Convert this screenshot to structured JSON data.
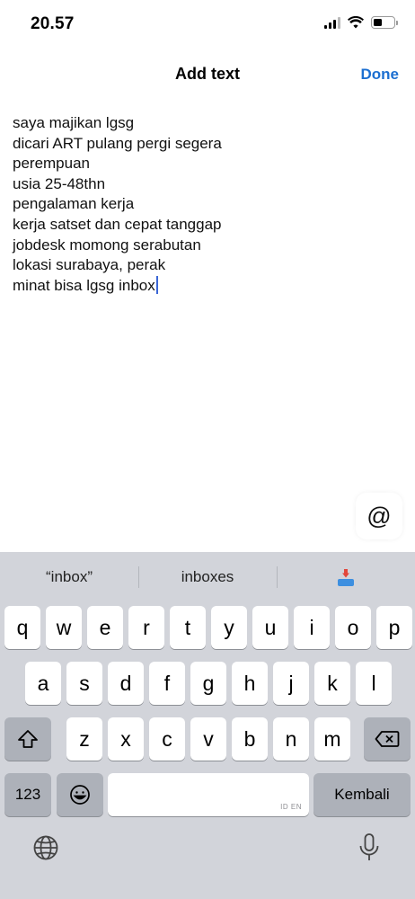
{
  "status": {
    "time": "20.57"
  },
  "nav": {
    "title": "Add text",
    "done_label": "Done"
  },
  "editor": {
    "lines": [
      "saya majikan lgsg",
      "dicari ART pulang pergi segera",
      "perempuan",
      "usia 25-48thn",
      "pengalaman kerja",
      "kerja satset dan cepat tanggap",
      "jobdesk momong serabutan",
      "lokasi surabaya, perak",
      "minat bisa lgsg inbox"
    ]
  },
  "mention": {
    "label": "@"
  },
  "keyboard": {
    "suggestions": [
      "“inbox”",
      "inboxes"
    ],
    "suggestion_emoji": "inbox-tray-emoji",
    "row1": [
      "q",
      "w",
      "e",
      "r",
      "t",
      "y",
      "u",
      "i",
      "o",
      "p"
    ],
    "row2": [
      "a",
      "s",
      "d",
      "f",
      "g",
      "h",
      "j",
      "k",
      "l"
    ],
    "row3": [
      "z",
      "x",
      "c",
      "v",
      "b",
      "n",
      "m"
    ],
    "numbers_label": "123",
    "space_hint": "ID EN",
    "return_label": "Kembali"
  },
  "colors": {
    "accent": "#1c6fd1",
    "keyboard_bg": "#d2d4da",
    "caret": "#3a66d6"
  }
}
